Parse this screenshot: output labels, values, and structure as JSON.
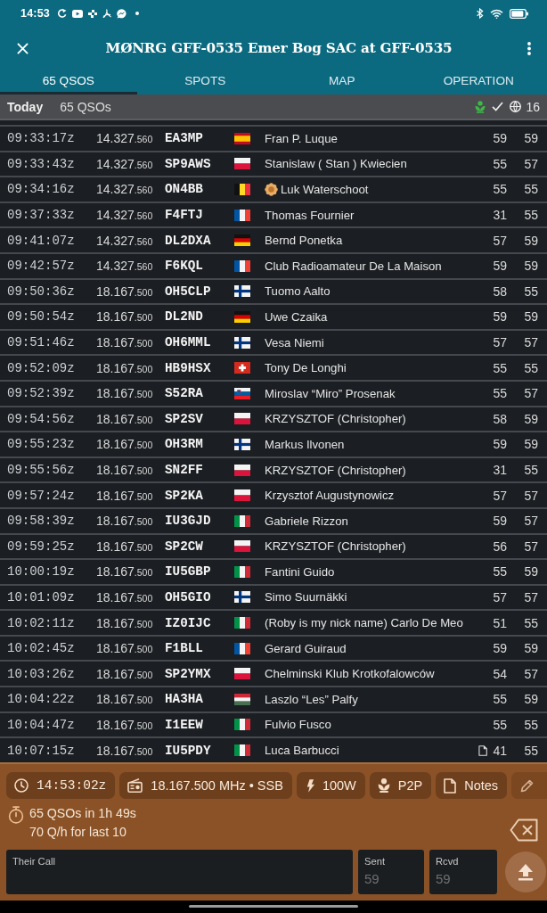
{
  "status_bar": {
    "time": "14:53"
  },
  "app_bar": {
    "title": "MØNRG GFF-0535 Emer Bog SAC at GFF-0535"
  },
  "tabs": [
    {
      "label": "65 QSOS",
      "selected": true
    },
    {
      "label": "SPOTS",
      "selected": false
    },
    {
      "label": "MAP",
      "selected": false
    },
    {
      "label": "OPERATION",
      "selected": false
    }
  ],
  "section_header": {
    "title": "Today",
    "count": "65 QSOs",
    "countries": "16"
  },
  "qsos": [
    {
      "time": "09:33:17z",
      "freq": "14.327",
      "freq_fine": ".560",
      "call": "EA3MP",
      "flag": {
        "kind": "es"
      },
      "name": "Fran P. Luque",
      "name_badge": false,
      "has_notes": false,
      "sent": "59",
      "rcvd": "59"
    },
    {
      "time": "09:33:43z",
      "freq": "14.327",
      "freq_fine": ".560",
      "call": "SP9AWS",
      "flag": {
        "kind": "pl"
      },
      "name": "Stanislaw ( Stan ) Kwiecien",
      "name_badge": false,
      "has_notes": false,
      "sent": "55",
      "rcvd": "57"
    },
    {
      "time": "09:34:16z",
      "freq": "14.327",
      "freq_fine": ".560",
      "call": "ON4BB",
      "flag": {
        "kind": "be"
      },
      "name": "Luk Waterschoot",
      "name_badge": true,
      "has_notes": false,
      "sent": "55",
      "rcvd": "55"
    },
    {
      "time": "09:37:33z",
      "freq": "14.327",
      "freq_fine": ".560",
      "call": "F4FTJ",
      "flag": {
        "kind": "fr"
      },
      "name": "Thomas Fournier",
      "name_badge": false,
      "has_notes": false,
      "sent": "31",
      "rcvd": "55"
    },
    {
      "time": "09:41:07z",
      "freq": "14.327",
      "freq_fine": ".560",
      "call": "DL2DXA",
      "flag": {
        "kind": "de"
      },
      "name": "Bernd Ponetka",
      "name_badge": false,
      "has_notes": false,
      "sent": "57",
      "rcvd": "59"
    },
    {
      "time": "09:42:57z",
      "freq": "14.327",
      "freq_fine": ".560",
      "call": "F6KQL",
      "flag": {
        "kind": "fr"
      },
      "name": "Club Radioamateur De La Maison",
      "name_badge": false,
      "has_notes": false,
      "sent": "59",
      "rcvd": "59"
    },
    {
      "time": "09:50:36z",
      "freq": "18.167",
      "freq_fine": ".500",
      "call": "OH5CLP",
      "flag": {
        "kind": "fi"
      },
      "name": "Tuomo Aalto",
      "name_badge": false,
      "has_notes": false,
      "sent": "58",
      "rcvd": "55"
    },
    {
      "time": "09:50:54z",
      "freq": "18.167",
      "freq_fine": ".500",
      "call": "DL2ND",
      "flag": {
        "kind": "de"
      },
      "name": "Uwe Czaika",
      "name_badge": false,
      "has_notes": false,
      "sent": "59",
      "rcvd": "59"
    },
    {
      "time": "09:51:46z",
      "freq": "18.167",
      "freq_fine": ".500",
      "call": "OH6MML",
      "flag": {
        "kind": "fi"
      },
      "name": "Vesa Niemi",
      "name_badge": false,
      "has_notes": false,
      "sent": "57",
      "rcvd": "57"
    },
    {
      "time": "09:52:09z",
      "freq": "18.167",
      "freq_fine": ".500",
      "call": "HB9HSX",
      "flag": {
        "kind": "ch"
      },
      "name": "Tony De Longhi",
      "name_badge": false,
      "has_notes": false,
      "sent": "55",
      "rcvd": "55"
    },
    {
      "time": "09:52:39z",
      "freq": "18.167",
      "freq_fine": ".500",
      "call": "S52RA",
      "flag": {
        "kind": "si"
      },
      "name": "Miroslav “Miro” Prosenak",
      "name_badge": false,
      "has_notes": false,
      "sent": "55",
      "rcvd": "57"
    },
    {
      "time": "09:54:56z",
      "freq": "18.167",
      "freq_fine": ".500",
      "call": "SP2SV",
      "flag": {
        "kind": "pl"
      },
      "name": "KRZYSZTOF (Christopher)",
      "name_badge": false,
      "has_notes": false,
      "sent": "58",
      "rcvd": "59"
    },
    {
      "time": "09:55:23z",
      "freq": "18.167",
      "freq_fine": ".500",
      "call": "OH3RM",
      "flag": {
        "kind": "fi"
      },
      "name": "Markus Ilvonen",
      "name_badge": false,
      "has_notes": false,
      "sent": "59",
      "rcvd": "59"
    },
    {
      "time": "09:55:56z",
      "freq": "18.167",
      "freq_fine": ".500",
      "call": "SN2FF",
      "flag": {
        "kind": "pl"
      },
      "name": "KRZYSZTOF (Christopher)",
      "name_badge": false,
      "has_notes": false,
      "sent": "31",
      "rcvd": "55"
    },
    {
      "time": "09:57:24z",
      "freq": "18.167",
      "freq_fine": ".500",
      "call": "SP2KA",
      "flag": {
        "kind": "pl"
      },
      "name": "Krzysztof Augustynowicz",
      "name_badge": false,
      "has_notes": false,
      "sent": "57",
      "rcvd": "57"
    },
    {
      "time": "09:58:39z",
      "freq": "18.167",
      "freq_fine": ".500",
      "call": "IU3GJD",
      "flag": {
        "kind": "it"
      },
      "name": "Gabriele Rizzon",
      "name_badge": false,
      "has_notes": false,
      "sent": "59",
      "rcvd": "57"
    },
    {
      "time": "09:59:25z",
      "freq": "18.167",
      "freq_fine": ".500",
      "call": "SP2CW",
      "flag": {
        "kind": "pl"
      },
      "name": "KRZYSZTOF (Christopher)",
      "name_badge": false,
      "has_notes": false,
      "sent": "56",
      "rcvd": "57"
    },
    {
      "time": "10:00:19z",
      "freq": "18.167",
      "freq_fine": ".500",
      "call": "IU5GBP",
      "flag": {
        "kind": "it"
      },
      "name": "Fantini Guido",
      "name_badge": false,
      "has_notes": false,
      "sent": "55",
      "rcvd": "59"
    },
    {
      "time": "10:01:09z",
      "freq": "18.167",
      "freq_fine": ".500",
      "call": "OH5GIO",
      "flag": {
        "kind": "fi"
      },
      "name": "Simo Suurnäkki",
      "name_badge": false,
      "has_notes": false,
      "sent": "57",
      "rcvd": "57"
    },
    {
      "time": "10:02:11z",
      "freq": "18.167",
      "freq_fine": ".500",
      "call": "IZ0IJC",
      "flag": {
        "kind": "it"
      },
      "name": "(Roby is my nick name) Carlo De Meo",
      "name_badge": false,
      "has_notes": false,
      "sent": "51",
      "rcvd": "55"
    },
    {
      "time": "10:02:45z",
      "freq": "18.167",
      "freq_fine": ".500",
      "call": "F1BLL",
      "flag": {
        "kind": "fr"
      },
      "name": "Gerard Guiraud",
      "name_badge": false,
      "has_notes": false,
      "sent": "59",
      "rcvd": "59"
    },
    {
      "time": "10:03:26z",
      "freq": "18.167",
      "freq_fine": ".500",
      "call": "SP2YMX",
      "flag": {
        "kind": "pl"
      },
      "name": "Chelminski Klub Krotkofalowców",
      "name_badge": false,
      "has_notes": false,
      "sent": "54",
      "rcvd": "57"
    },
    {
      "time": "10:04:22z",
      "freq": "18.167",
      "freq_fine": ".500",
      "call": "HA3HA",
      "flag": {
        "kind": "hu"
      },
      "name": "Laszlo “Les” Palfy",
      "name_badge": false,
      "has_notes": false,
      "sent": "55",
      "rcvd": "59"
    },
    {
      "time": "10:04:47z",
      "freq": "18.167",
      "freq_fine": ".500",
      "call": "I1EEW",
      "flag": {
        "kind": "it"
      },
      "name": "Fulvio Fusco",
      "name_badge": false,
      "has_notes": false,
      "sent": "55",
      "rcvd": "55"
    },
    {
      "time": "10:07:15z",
      "freq": "18.167",
      "freq_fine": ".500",
      "call": "IU5PDY",
      "flag": {
        "kind": "it"
      },
      "name": "Luca Barbucci",
      "name_badge": false,
      "has_notes": true,
      "sent": "41",
      "rcvd": "55"
    }
  ],
  "info_chips": [
    {
      "kind": "time",
      "text": "14:53:02z"
    },
    {
      "kind": "frequency",
      "text": "18.167.500 MHz • SSB"
    },
    {
      "kind": "power",
      "text": "100W"
    },
    {
      "kind": "p2p",
      "text": "P2P"
    },
    {
      "kind": "notes",
      "text": "Notes"
    },
    {
      "kind": "edit"
    }
  ],
  "stats": {
    "lines": [
      "65 QSOs in 1h 49s",
      "70 Q/h for last 10"
    ]
  },
  "fields": [
    {
      "label": "Their Call"
    },
    {
      "label": "Sent",
      "placeholder": "59"
    },
    {
      "label": "Rcvd",
      "placeholder": "59"
    }
  ]
}
